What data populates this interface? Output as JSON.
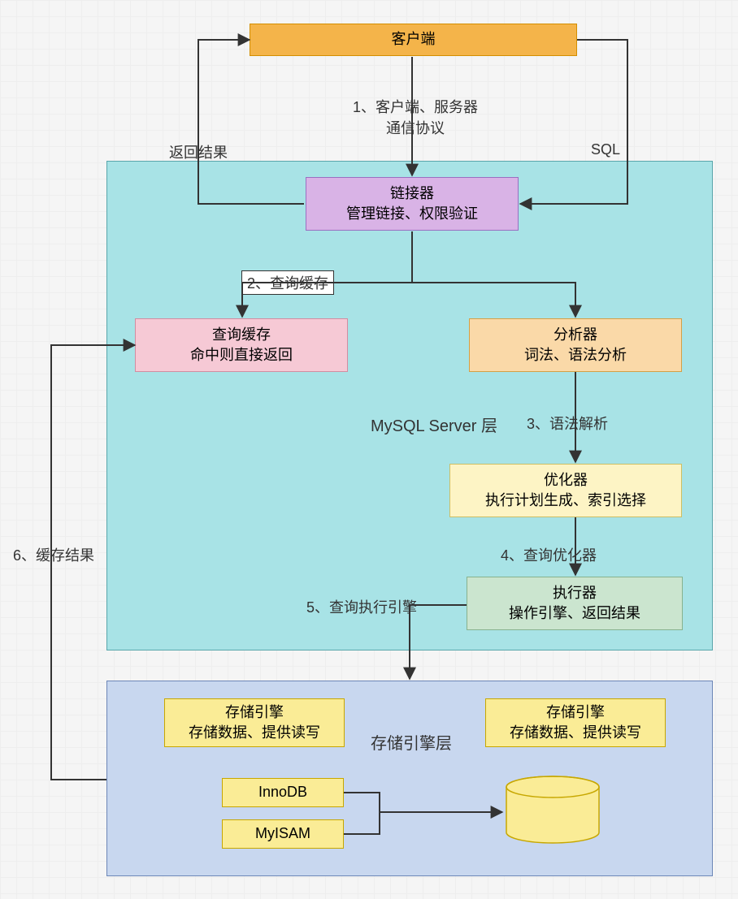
{
  "nodes": {
    "client": "客户端",
    "connector": {
      "l1": "链接器",
      "l2": "管理链接、权限验证"
    },
    "cache": {
      "l1": "查询缓存",
      "l2": "命中则直接返回"
    },
    "analyzer": {
      "l1": "分析器",
      "l2": "词法、语法分析"
    },
    "optimizer": {
      "l1": "优化器",
      "l2": "执行计划生成、索引选择"
    },
    "executor": {
      "l1": "执行器",
      "l2": "操作引擎、返回结果"
    },
    "engine1": {
      "l1": "存储引擎",
      "l2": "存储数据、提供读写"
    },
    "engine2": {
      "l1": "存储引擎",
      "l2": "存储数据、提供读写"
    },
    "innodb": "InnoDB",
    "myisam": "MyISAM",
    "data": "数据"
  },
  "regions": {
    "server": "MySQL Server 层",
    "storage": "存储引擎层"
  },
  "edges": {
    "e1": "1、客户端、服务器\n通信协议",
    "e2": "2、查询缓存",
    "e3": "3、语法解析",
    "e4": "4、查询优化器",
    "e5": "5、查询执行引擎",
    "e6": "6、缓存结果",
    "ret": "返回结果",
    "sql": "SQL"
  },
  "colors": {
    "orange": "#f4b44a",
    "orangeBorder": "#d38e00",
    "purple": "#d9b3e6",
    "purpleBorder": "#9a6fc1",
    "pink": "#f6c9d5",
    "pinkBorder": "#d28da1",
    "peach": "#fad9a8",
    "peachBorder": "#d4a046",
    "lemon": "#fdf4c5",
    "lemonBorder": "#cdbf64",
    "green": "#cbe5cf",
    "greenBorder": "#87b28e",
    "yellow": "#faec96",
    "yellowBorder": "#c7a700",
    "cyan": "#a8e3e6",
    "cyanBorder": "#59a6ab",
    "blue": "#c8d7ef",
    "blueBorder": "#6c86b7"
  }
}
